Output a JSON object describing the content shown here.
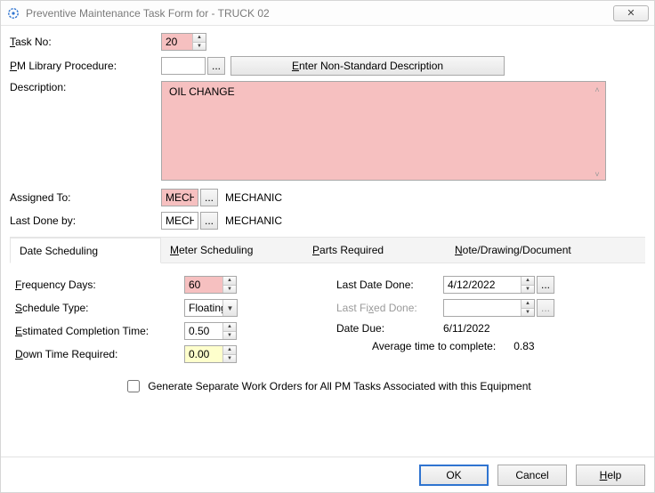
{
  "window": {
    "title": "Preventive Maintenance Task Form for - TRUCK 02",
    "close_symbol": "✕"
  },
  "top": {
    "task_no_label_pre": "T",
    "task_no_label_rest": "ask No:",
    "task_no_value": "20",
    "pm_lib_label_pre": "P",
    "pm_lib_label_rest": "M Library Procedure:",
    "pm_lib_value": "",
    "enter_nonstd_pre": "E",
    "enter_nonstd_rest": "nter Non-Standard Description",
    "desc_label": "Description:",
    "desc_value": "OIL CHANGE",
    "assigned_to_label": "Assigned To:",
    "assigned_to_code": "MECH",
    "assigned_to_name": "MECHANIC",
    "last_done_by_label": "Last Done by:",
    "last_done_by_code": "MECH",
    "last_done_by_name": "MECHANIC",
    "ellipsis": "..."
  },
  "tabs": [
    {
      "pre": "",
      "rest": "Date Scheduling"
    },
    {
      "pre": "M",
      "rest": "eter Scheduling"
    },
    {
      "pre": "P",
      "rest": "arts Required"
    },
    {
      "pre": "N",
      "rest": "ote/Drawing/Document"
    }
  ],
  "sched": {
    "freq_label_pre": "F",
    "freq_label_rest": "requency Days:",
    "freq_value": "60",
    "schedtype_label_pre": "S",
    "schedtype_label_rest": "chedule Type:",
    "schedtype_value": "Floating",
    "ect_label_pre": "E",
    "ect_label_rest": "stimated Completion Time:",
    "ect_value": "0.50",
    "dtr_label_pre": "D",
    "dtr_label_rest": "own Time Required:",
    "dtr_value": "0.00",
    "last_date_done_label": "Last Date Done:",
    "last_date_done_value": "4/12/2022",
    "last_fixed_label_pre": "Last Fi",
    "last_fixed_label_u": "x",
    "last_fixed_label_post": "ed Done:",
    "last_fixed_value": "",
    "date_due_label": "Date Due:",
    "date_due_value": "6/11/2022",
    "avg_label": "Average time to complete:",
    "avg_value": "0.83",
    "gen_sep_label": "Generate Separate Work Orders for All PM Tasks Associated with this Equipment",
    "ellipsis": "..."
  },
  "footer": {
    "ok": "OK",
    "cancel": "Cancel",
    "help_pre": "H",
    "help_rest": "elp"
  }
}
